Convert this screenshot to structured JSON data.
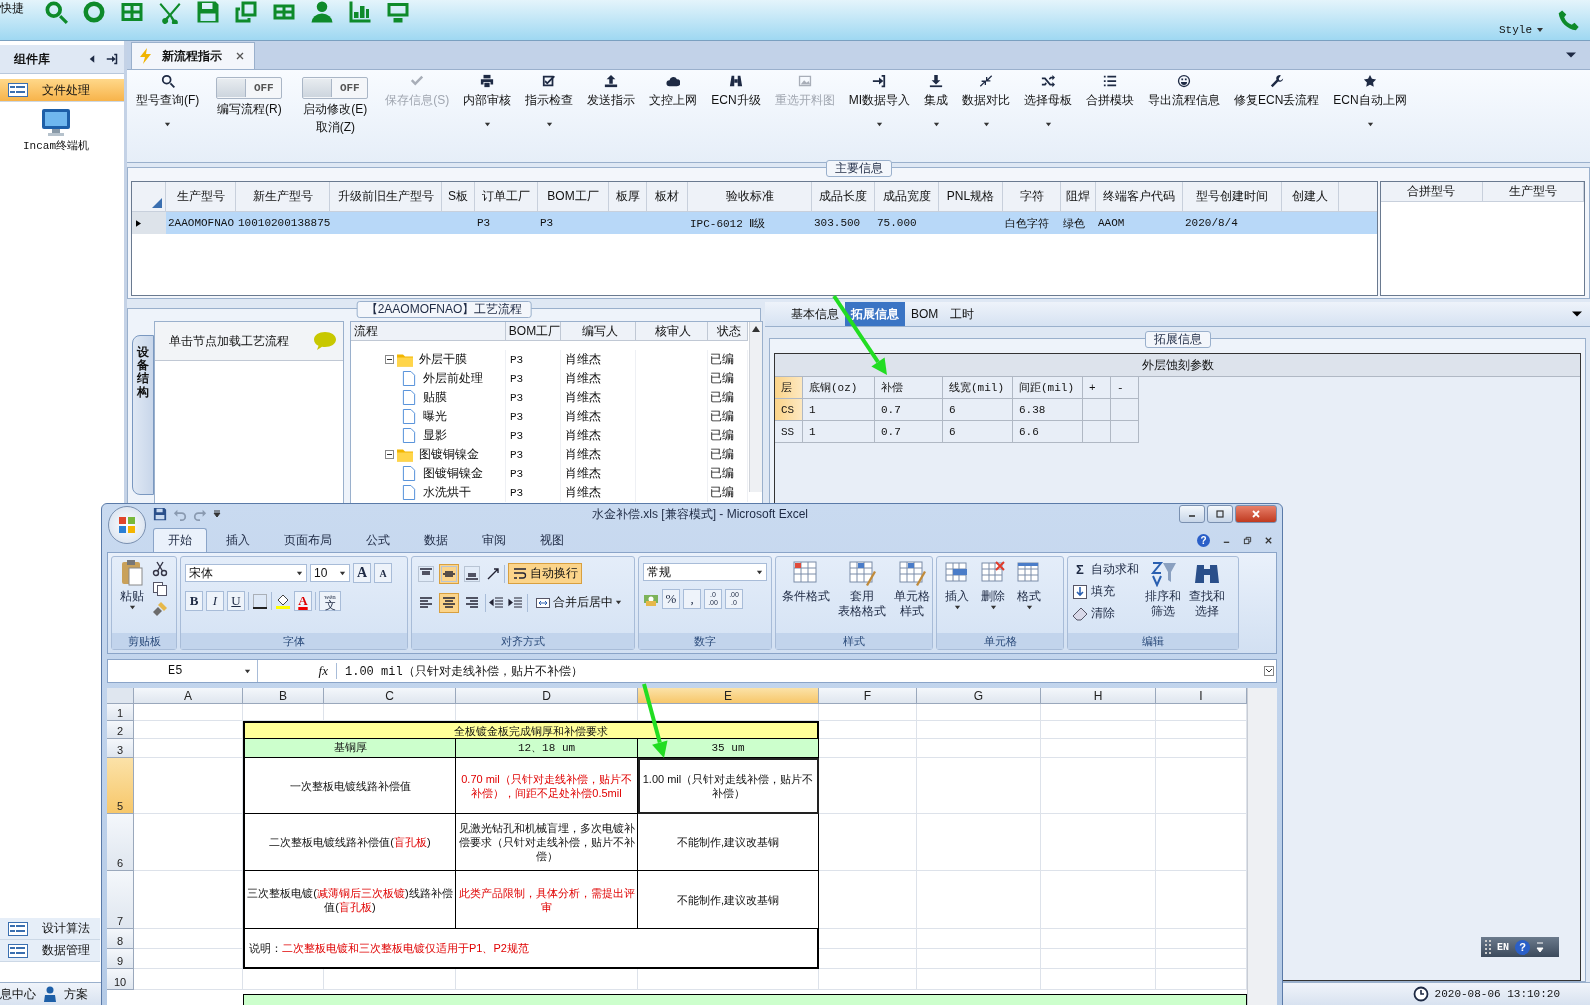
{
  "launcher": {
    "caption": "快捷",
    "style_menu": "Style"
  },
  "sidebar": {
    "title": "组件库",
    "items": [
      {
        "label": "文件处理",
        "selected": true
      }
    ],
    "tools": [
      {
        "label": "Incam终端机"
      }
    ],
    "bottom_items": [
      {
        "label": "设计算法",
        "selected": false
      },
      {
        "label": "数据管理",
        "selected": false
      }
    ]
  },
  "doc_tabs": [
    {
      "label": "新流程指示",
      "selected": true
    }
  ],
  "ribbon": [
    {
      "kind": "button",
      "label": "型号查询(F)",
      "dropdown": true,
      "disabled": false
    },
    {
      "kind": "toggle",
      "label": "编写流程(R)",
      "switch_text": "OFF",
      "on": false
    },
    {
      "kind": "toggle",
      "label": "启动修改(E)",
      "label_2": "取消(Z)",
      "switch_text": "OFF",
      "on": false
    },
    {
      "kind": "button",
      "label": "保存信息(S)",
      "dropdown": false,
      "disabled": true
    },
    {
      "kind": "button",
      "label": "内部审核",
      "dropdown": true,
      "disabled": false
    },
    {
      "kind": "button",
      "label": "指示检查",
      "dropdown": true,
      "disabled": false
    },
    {
      "kind": "button",
      "label": "发送指示",
      "dropdown": false,
      "disabled": false
    },
    {
      "kind": "button",
      "label": "文控上网",
      "dropdown": false,
      "disabled": false
    },
    {
      "kind": "button",
      "label": "ECN升级",
      "dropdown": false,
      "disabled": false
    },
    {
      "kind": "button",
      "label": "重选开料图",
      "dropdown": false,
      "disabled": true
    },
    {
      "kind": "button",
      "label": "MI数据导入",
      "dropdown": true,
      "disabled": false
    },
    {
      "kind": "button",
      "label": "集成",
      "dropdown": true,
      "disabled": false
    },
    {
      "kind": "button",
      "label": "数据对比",
      "dropdown": true,
      "disabled": false
    },
    {
      "kind": "button",
      "label": "选择母板",
      "dropdown": true,
      "disabled": false
    },
    {
      "kind": "button",
      "label": "合拼模块",
      "dropdown": false,
      "disabled": false
    },
    {
      "kind": "button",
      "label": "导出流程信息",
      "dropdown": false,
      "disabled": false
    },
    {
      "kind": "button",
      "label": "修复ECN丢流程",
      "dropdown": false,
      "disabled": false
    },
    {
      "kind": "button",
      "label": "ECN自动上网",
      "dropdown": true,
      "disabled": false
    }
  ],
  "main_info": {
    "title": "主要信息",
    "columns": [
      "生产型号",
      "新生产型号",
      "升级前旧生产型号",
      "S板",
      "订单工厂",
      "BOM工厂",
      "板厚",
      "板材",
      "验收标准",
      "成品长度",
      "成品宽度",
      "PNL规格",
      "字符",
      "阻焊",
      "终端客户代码",
      "型号创建时间",
      "创建人"
    ],
    "rows": [
      {
        "selected": true,
        "cells": [
          "2AAOMOFNAO",
          "10010200138875",
          null,
          null,
          "P3",
          "P3",
          null,
          null,
          "IPC-6012 Ⅱ级",
          "303.500",
          "75.000",
          null,
          "白色字符",
          "绿色",
          "AAOM",
          "2020/8/4",
          null
        ]
      }
    ]
  },
  "merge_grid": {
    "columns": [
      "合拼型号",
      "生产型号"
    ]
  },
  "process": {
    "title": "【2AAOMOFNAO】工艺流程",
    "side_tab": "设备结构",
    "hint": "单击节点加载工艺流程",
    "columns": [
      "流程",
      "BOM工厂",
      "编写人",
      "核审人",
      "状态"
    ],
    "tree": [
      {
        "kind": "folder",
        "label": "外层干膜",
        "expanded": true,
        "bom": "P3",
        "writer": "肖维杰",
        "status": "已编",
        "children": [
          {
            "kind": "file",
            "label": "外层前处理",
            "bom": "P3",
            "writer": "肖维杰",
            "status": "已编"
          },
          {
            "kind": "file",
            "label": "贴膜",
            "bom": "P3",
            "writer": "肖维杰",
            "status": "已编"
          },
          {
            "kind": "file",
            "label": "曝光",
            "bom": "P3",
            "writer": "肖维杰",
            "status": "已编"
          },
          {
            "kind": "file",
            "label": "显影",
            "bom": "P3",
            "writer": "肖维杰",
            "status": "已编"
          }
        ]
      },
      {
        "kind": "folder",
        "label": "图镀铜镍金",
        "expanded": true,
        "bom": "P3",
        "writer": "肖维杰",
        "status": "已编",
        "children": [
          {
            "kind": "file",
            "label": "图镀铜镍金",
            "bom": "P3",
            "writer": "肖维杰",
            "status": "已编"
          },
          {
            "kind": "file",
            "label": "水洗烘干",
            "bom": "P3",
            "writer": "肖维杰",
            "status": "已编"
          }
        ]
      }
    ]
  },
  "detail": {
    "tabs": [
      {
        "label": "基本信息",
        "selected": false
      },
      {
        "label": "拓展信息",
        "selected": true
      },
      {
        "label": "BOM",
        "selected": false
      },
      {
        "label": "工时",
        "selected": false
      }
    ],
    "group_title": "拓展信息",
    "table": {
      "title": "外层蚀刻参数",
      "columns": [
        "层",
        "底铜(oz)",
        "补偿",
        "线宽(mil)",
        "间距(mil)",
        "+",
        "-"
      ],
      "rows": [
        {
          "selected": true,
          "cells": [
            "CS",
            "1",
            "0.7",
            "6",
            "6.38"
          ]
        },
        {
          "selected": false,
          "cells": [
            "SS",
            "1",
            "0.7",
            "6",
            "6.6"
          ]
        }
      ]
    }
  },
  "status_bar": {
    "items": [
      "息中心",
      "方案"
    ],
    "datetime": "2020-08-06 13:10:20"
  },
  "language_bar": {
    "label": "EN",
    "help": "?"
  },
  "excel": {
    "title": "水金补偿.xls  [兼容模式] - Microsoft Excel",
    "help": "?",
    "tabs": [
      {
        "label": "开始",
        "selected": true
      },
      {
        "label": "插入",
        "selected": false
      },
      {
        "label": "页面布局",
        "selected": false
      },
      {
        "label": "公式",
        "selected": false
      },
      {
        "label": "数据",
        "selected": false
      },
      {
        "label": "审阅",
        "selected": false
      },
      {
        "label": "视图",
        "selected": false
      }
    ],
    "clipboard": {
      "paste": "粘贴",
      "group": "剪贴板"
    },
    "font": {
      "name": "宋体",
      "size": "10",
      "grow": "A",
      "shrink": "A",
      "bold": "B",
      "italic": "I",
      "underline": "U",
      "color_button": "A",
      "phonetic": "wén",
      "phonetic_char": "文",
      "group": "字体"
    },
    "alignment": {
      "vertical": [
        {
          "selected": false
        },
        {
          "selected": true
        },
        {
          "selected": false
        }
      ],
      "horizontal": [
        {
          "selected": false
        },
        {
          "selected": true
        },
        {
          "selected": false
        }
      ],
      "wrap": "自动换行",
      "wrap_on": true,
      "merge": "合并后居中",
      "group": "对齐方式"
    },
    "number": {
      "format": "常规",
      "percent": "%",
      "comma": ",",
      "increase_decimal": [
        ".0",
        ".00"
      ],
      "decrease_decimal": [
        ".00",
        ".0"
      ],
      "group": "数字"
    },
    "styles": {
      "buttons": [
        [
          "条件格式"
        ],
        [
          "套用",
          "表格格式"
        ],
        [
          "单元格",
          "样式"
        ]
      ],
      "group": "样式"
    },
    "cells": {
      "buttons": [
        "插入",
        "删除",
        "格式"
      ],
      "group": "单元格"
    },
    "editing": {
      "autosum_symbol": "Σ",
      "autosum": "自动求和",
      "fill": "填充",
      "clear": "清除",
      "sort": [
        "排序和",
        "筛选"
      ],
      "find": [
        "查找和",
        "选择"
      ],
      "group": "编辑"
    },
    "formula_bar": {
      "name_box": "E5",
      "fx": "fx",
      "formula": "1.00 mil（只针对走线补偿，贴片不补偿）"
    },
    "columns": [
      {
        "label": "A",
        "selected": false
      },
      {
        "label": "B",
        "selected": false
      },
      {
        "label": "C",
        "selected": false
      },
      {
        "label": "D",
        "selected": false
      },
      {
        "label": "E",
        "selected": true
      },
      {
        "label": "F",
        "selected": false
      },
      {
        "label": "G",
        "selected": false
      },
      {
        "label": "H",
        "selected": false
      },
      {
        "label": "I",
        "selected": false
      }
    ],
    "rows": [
      {
        "label": "1",
        "selected": false
      },
      {
        "label": "2",
        "selected": false
      },
      {
        "label": "3",
        "selected": false
      },
      {
        "label": "5",
        "selected": true
      },
      {
        "label": "6",
        "selected": false
      },
      {
        "label": "7",
        "selected": false
      },
      {
        "label": "8",
        "selected": false
      },
      {
        "label": "9",
        "selected": false
      },
      {
        "label": "10",
        "selected": false
      }
    ],
    "table": {
      "title": "全板镀金板完成铜厚和补偿要求",
      "header": [
        "基铜厚",
        "12、18 um",
        "35 um"
      ],
      "rows": [
        {
          "cells": [
            [
              {
                "text": "一次整板电镀线路补偿值",
                "highlight": false
              }
            ],
            [
              {
                "text": "0.70 mil（只针对走线补偿，贴片不补偿），间距不足处补偿0.5mil",
                "highlight": true
              }
            ],
            [
              {
                "text": "1.00 mil（只针对走线补偿，贴片不补偿）",
                "highlight": false
              }
            ]
          ]
        },
        {
          "cells": [
            [
              {
                "text": "二次整板电镀线路补偿值(",
                "highlight": false
              },
              {
                "text": "盲孔板",
                "highlight": true
              },
              {
                "text": ")",
                "highlight": false
              }
            ],
            [
              {
                "text": "见激光钻孔和机械盲埋，多次电镀补偿要求（只针对走线补偿，贴片不补偿）",
                "highlight": false
              }
            ],
            [
              {
                "text": "不能制作,建议改基铜",
                "highlight": false
              }
            ]
          ]
        },
        {
          "cells": [
            [
              {
                "text": "三次整板电镀(",
                "highlight": false
              },
              {
                "text": "减薄铜后三次板镀",
                "highlight": true
              },
              {
                "text": ")线路补偿值(",
                "highlight": false
              },
              {
                "text": "盲孔板",
                "highlight": true
              },
              {
                "text": ")",
                "highlight": false
              }
            ],
            [
              {
                "text": "此类产品限制，具体分析，需提出评审",
                "highlight": true
              }
            ],
            [
              {
                "text": "不能制作,建议改基铜",
                "highlight": false
              }
            ]
          ]
        }
      ],
      "note": [
        {
          "text": "说明：",
          "highlight": false
        },
        {
          "text": "二次整板电镀和三次整板电镀仅适用于P1、P2规范",
          "highlight": true
        }
      ]
    }
  }
}
